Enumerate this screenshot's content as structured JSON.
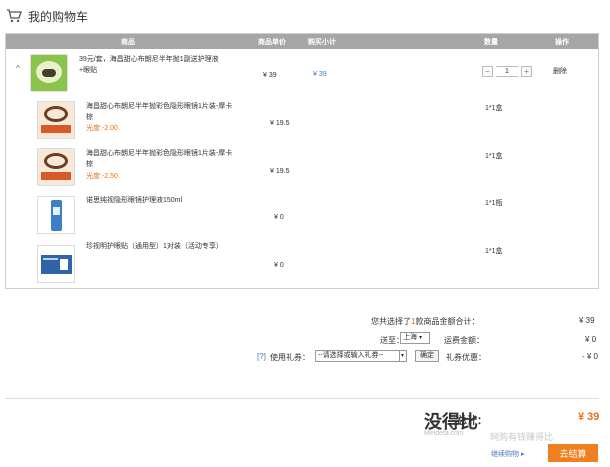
{
  "header": {
    "title": "我的购物车",
    "icon": "cart-icon"
  },
  "table": {
    "columns": [
      "商品",
      "商品单价",
      "购买小计",
      "数量",
      "操作"
    ]
  },
  "main_item": {
    "name": "39元/套，海昌甜心布朗尼半年抛1副送护理液+眼贴",
    "price": "¥ 39",
    "subtotal": "¥ 39",
    "quantity": "1",
    "qty_minus": "−",
    "qty_plus": "+",
    "delete": "删除",
    "toggle": "^"
  },
  "sub_items": [
    {
      "name": "海昌甜心布朗尼半年抛彩色隐形眼镜1片装-摩卡棕",
      "power": "光度:-2.00",
      "price": "¥ 19.5",
      "qty": "1*1盒"
    },
    {
      "name": "海昌甜心布朗尼半年抛彩色隐形眼镜1片装-摩卡棕",
      "power": "光度:-2.50",
      "price": "¥ 19.5",
      "qty": "1*1盒"
    },
    {
      "name": "诺思纯视隐形眼镜护理液150ml",
      "power": "",
      "price": "¥ 0",
      "qty": "1*1瓶"
    },
    {
      "name": "珍视明护眼贴（通用型）1对装（活动专享）",
      "power": "",
      "price": "¥ 0",
      "qty": "1*1盒"
    }
  ],
  "summary": {
    "selected_prefix": "您共选择了",
    "selected_count": "1",
    "selected_suffix": "款商品金额合计：",
    "selected_total": "¥ 39",
    "ship_to_label": "送至：",
    "ship_to_value": "上海",
    "shipping_label": "运费金额：",
    "shipping_value": "¥ 0",
    "coupon_help": "[?]",
    "coupon_label": "使用礼券：",
    "coupon_placeholder": "--请选择或输入礼券--",
    "coupon_confirm": "确定",
    "coupon_discount_label": "礼券优惠：",
    "coupon_discount_value": "- ¥ 0"
  },
  "footer": {
    "total_label": "总计：",
    "total_value": "¥ 39",
    "continue_label": "继续购物",
    "checkout_label": "去结算",
    "watermark_main": "没得比",
    "watermark_sub": "Meidebi.com",
    "watermark_slogan": "网购有钱赚得比"
  },
  "colors": {
    "accent": "#f07f1f",
    "header_bar": "#a6a6a6",
    "link": "#4a78b8"
  }
}
